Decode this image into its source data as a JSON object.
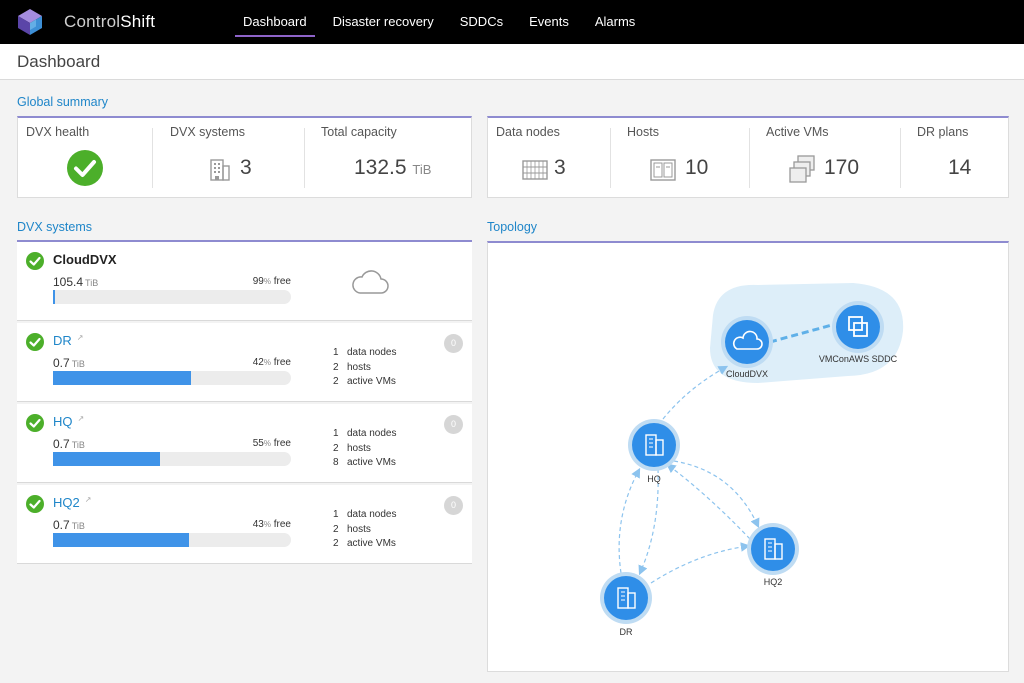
{
  "app": {
    "brand_prefix": "Control",
    "brand_suffix": "Shift"
  },
  "nav": {
    "items": [
      {
        "label": "Dashboard",
        "active": true
      },
      {
        "label": "Disaster recovery",
        "active": false
      },
      {
        "label": "SDDCs",
        "active": false
      },
      {
        "label": "Events",
        "active": false
      },
      {
        "label": "Alarms",
        "active": false
      }
    ]
  },
  "page": {
    "title": "Dashboard"
  },
  "global_summary": {
    "title": "Global summary",
    "dvx_health": {
      "label": "DVX health",
      "status_icon": "check-circle-icon",
      "status_color": "#4caf2a"
    },
    "dvx_systems": {
      "label": "DVX systems",
      "value": "3",
      "icon": "building-icon"
    },
    "total_capacity": {
      "label": "Total capacity",
      "value": "132.5",
      "unit": "TiB"
    },
    "data_nodes": {
      "label": "Data nodes",
      "value": "3",
      "icon": "server-rack-icon"
    },
    "hosts": {
      "label": "Hosts",
      "value": "10",
      "icon": "host-icon"
    },
    "active_vms": {
      "label": "Active VMs",
      "value": "170",
      "icon": "vm-stack-icon"
    },
    "dr_plans": {
      "label": "DR plans",
      "value": "14"
    }
  },
  "dvx_systems": {
    "title": "DVX systems",
    "items": [
      {
        "name": "CloudDVX",
        "capacity": "105.4",
        "unit": "TiB",
        "free_pct": "99",
        "free_label": "free",
        "fill_pct": 1,
        "icon": "cloud-icon"
      },
      {
        "name": "DR",
        "capacity": "0.7",
        "unit": "TiB",
        "free_pct": "42",
        "free_label": "free",
        "fill_pct": 58,
        "data_nodes": "1",
        "hosts": "2",
        "active_vms": "2",
        "alarms": "0"
      },
      {
        "name": "HQ",
        "capacity": "0.7",
        "unit": "TiB",
        "free_pct": "55",
        "free_label": "free",
        "fill_pct": 45,
        "data_nodes": "1",
        "hosts": "2",
        "active_vms": "8",
        "alarms": "0"
      },
      {
        "name": "HQ2",
        "capacity": "0.7",
        "unit": "TiB",
        "free_pct": "43",
        "free_label": "free",
        "fill_pct": 57,
        "data_nodes": "1",
        "hosts": "2",
        "active_vms": "2",
        "alarms": "0"
      }
    ],
    "labels": {
      "data_nodes": "data nodes",
      "hosts": "hosts",
      "active_vms": "active VMs",
      "pct": "%"
    }
  },
  "topology": {
    "title": "Topology",
    "nodes": {
      "clouddvx": "CloudDVX",
      "vmc": "VMConAWS SDDC",
      "hq": "HQ",
      "hq2": "HQ2",
      "dr": "DR"
    },
    "colors": {
      "node": "#2f8ee8",
      "edge": "#8cc3ee",
      "cloud_zone": "#ddeef9"
    }
  }
}
